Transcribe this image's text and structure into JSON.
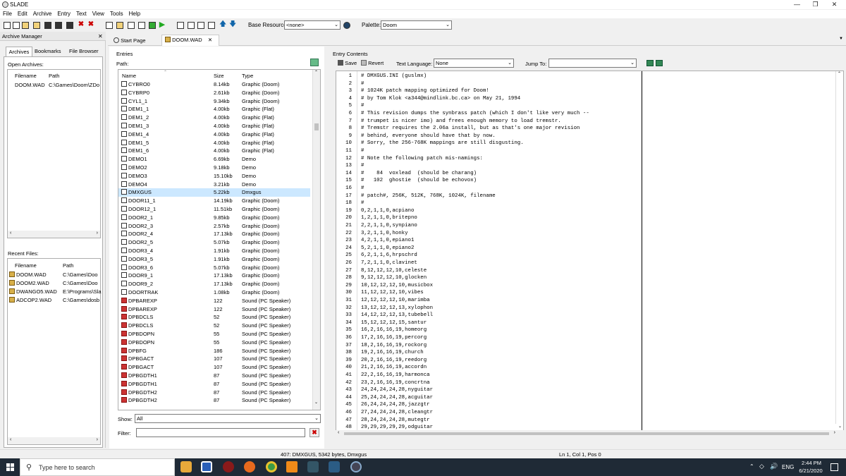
{
  "app": {
    "title": "SLADE"
  },
  "menu": [
    "File",
    "Edit",
    "Archive",
    "Entry",
    "Text",
    "View",
    "Tools",
    "Help"
  ],
  "toolbar": {
    "base_resource_label": "Base Resource:",
    "base_resource_value": "<none>",
    "palette_label": "Palette:",
    "palette_value": "Doom"
  },
  "archive_manager": {
    "title": "Archive Manager",
    "tabs": [
      "Archives",
      "Bookmarks",
      "File Browser"
    ],
    "open_archives_label": "Open Archives:",
    "columns": [
      "Filename",
      "Path"
    ],
    "open_archives": [
      {
        "filename": "DOOM.WAD",
        "path": "C:\\Games\\Doom\\ZDo"
      }
    ],
    "recent_label": "Recent Files:",
    "recent": [
      {
        "filename": "DOOM.WAD",
        "path": "C:\\Games\\Doo"
      },
      {
        "filename": "DOOM2.WAD",
        "path": "C:\\Games\\Doo"
      },
      {
        "filename": "DWANGO5.WAD",
        "path": "E:\\Programs\\Sla"
      },
      {
        "filename": "ADCOP2.WAD",
        "path": "C:\\Games\\dosb"
      }
    ]
  },
  "doc_tabs": [
    "Start Page",
    "DOOM.WAD"
  ],
  "entries": {
    "title": "Entries",
    "path_label": "Path:",
    "columns": [
      "Name",
      "Size",
      "Type"
    ],
    "rows": [
      {
        "name": "CYBRO0",
        "size": "8.14kb",
        "type": "Graphic (Doom)"
      },
      {
        "name": "CYBRP0",
        "size": "2.61kb",
        "type": "Graphic (Doom)"
      },
      {
        "name": "CYL1_1",
        "size": "9.34kb",
        "type": "Graphic (Doom)"
      },
      {
        "name": "DEM1_1",
        "size": "4.00kb",
        "type": "Graphic (Flat)"
      },
      {
        "name": "DEM1_2",
        "size": "4.00kb",
        "type": "Graphic (Flat)"
      },
      {
        "name": "DEM1_3",
        "size": "4.00kb",
        "type": "Graphic (Flat)"
      },
      {
        "name": "DEM1_4",
        "size": "4.00kb",
        "type": "Graphic (Flat)"
      },
      {
        "name": "DEM1_5",
        "size": "4.00kb",
        "type": "Graphic (Flat)"
      },
      {
        "name": "DEM1_6",
        "size": "4.00kb",
        "type": "Graphic (Flat)"
      },
      {
        "name": "DEMO1",
        "size": "6.69kb",
        "type": "Demo"
      },
      {
        "name": "DEMO2",
        "size": "9.18kb",
        "type": "Demo"
      },
      {
        "name": "DEMO3",
        "size": "15.10kb",
        "type": "Demo"
      },
      {
        "name": "DEMO4",
        "size": "3.21kb",
        "type": "Demo"
      },
      {
        "name": "DMXGUS",
        "size": "5.22kb",
        "type": "Dmxgus"
      },
      {
        "name": "DOOR11_1",
        "size": "14.19kb",
        "type": "Graphic (Doom)"
      },
      {
        "name": "DOOR12_1",
        "size": "11.51kb",
        "type": "Graphic (Doom)"
      },
      {
        "name": "DOOR2_1",
        "size": "9.85kb",
        "type": "Graphic (Doom)"
      },
      {
        "name": "DOOR2_3",
        "size": "2.57kb",
        "type": "Graphic (Doom)"
      },
      {
        "name": "DOOR2_4",
        "size": "17.13kb",
        "type": "Graphic (Doom)"
      },
      {
        "name": "DOOR2_5",
        "size": "5.07kb",
        "type": "Graphic (Doom)"
      },
      {
        "name": "DOOR3_4",
        "size": "1.91kb",
        "type": "Graphic (Doom)"
      },
      {
        "name": "DOOR3_5",
        "size": "1.91kb",
        "type": "Graphic (Doom)"
      },
      {
        "name": "DOOR3_6",
        "size": "5.07kb",
        "type": "Graphic (Doom)"
      },
      {
        "name": "DOOR9_1",
        "size": "17.13kb",
        "type": "Graphic (Doom)"
      },
      {
        "name": "DOOR9_2",
        "size": "17.13kb",
        "type": "Graphic (Doom)"
      },
      {
        "name": "DOORTRAK",
        "size": "1.08kb",
        "type": "Graphic (Doom)"
      },
      {
        "name": "DPBAREXP",
        "size": "122",
        "type": "Sound (PC Speaker)"
      },
      {
        "name": "DPBAREXP",
        "size": "122",
        "type": "Sound (PC Speaker)"
      },
      {
        "name": "DPBDCLS",
        "size": "52",
        "type": "Sound (PC Speaker)"
      },
      {
        "name": "DPBDCLS",
        "size": "52",
        "type": "Sound (PC Speaker)"
      },
      {
        "name": "DPBDOPN",
        "size": "55",
        "type": "Sound (PC Speaker)"
      },
      {
        "name": "DPBDOPN",
        "size": "55",
        "type": "Sound (PC Speaker)"
      },
      {
        "name": "DPBFG",
        "size": "186",
        "type": "Sound (PC Speaker)"
      },
      {
        "name": "DPBGACT",
        "size": "107",
        "type": "Sound (PC Speaker)"
      },
      {
        "name": "DPBGACT",
        "size": "107",
        "type": "Sound (PC Speaker)"
      },
      {
        "name": "DPBGDTH1",
        "size": "87",
        "type": "Sound (PC Speaker)"
      },
      {
        "name": "DPBGDTH1",
        "size": "87",
        "type": "Sound (PC Speaker)"
      },
      {
        "name": "DPBGDTH2",
        "size": "87",
        "type": "Sound (PC Speaker)"
      },
      {
        "name": "DPBGDTH2",
        "size": "87",
        "type": "Sound (PC Speaker)"
      }
    ],
    "show_label": "Show:",
    "show_value": "All",
    "filter_label": "Filter:"
  },
  "entry_contents": {
    "title": "Entry Contents",
    "save": "Save",
    "revert": "Revert",
    "text_language_label": "Text Language:",
    "text_language_value": "None",
    "jump_to_label": "Jump To:",
    "lines": [
      "# DMXGUS.INI (guslmx)",
      "#",
      "# 1024K patch mapping optimized for Doom!",
      "# by Tom Klok <a344@mindlink.bc.ca> on May 21, 1994",
      "#",
      "# This revision dumps the synbrass patch (which I don't like very much --",
      "# trumpet is nicer imo) and frees enough memory to load tremstr.",
      "# Tremstr requires the 2.06a install, but as that's one major revision",
      "# behind, everyone should have that by now.",
      "# Sorry, the 256-768K mappings are still disgusting.",
      "#",
      "# Note the following patch mis-namings:",
      "#",
      "#    84  voxlead  (should be charang)",
      "#   102  ghostie  (should be echovox)",
      "#",
      "# patch#, 256K, 512K, 768K, 1024K, filename",
      "#",
      "0,2,1,1,0,acpiano",
      "1,2,1,1,0,britepno",
      "2,2,1,1,0,synpiano",
      "3,2,1,1,0,honky",
      "4,2,1,1,0,epiano1",
      "5,2,1,1,0,epiano2",
      "6,2,1,1,6,hrpschrd",
      "7,2,1,1,0,clavinet",
      "8,12,12,12,10,celeste",
      "9,12,12,12,10,glocken",
      "10,12,12,12,10,musicbox",
      "11,12,12,12,10,vibes",
      "12,12,12,12,10,marimba",
      "13,12,12,12,13,xylophon",
      "14,12,12,12,13,tubebell",
      "15,12,12,12,15,santur",
      "16,2,16,16,19,homeorg",
      "17,2,16,16,19,percorg",
      "18,2,16,16,19,rockorg",
      "19,2,16,16,19,church",
      "20,2,16,16,19,reedorg",
      "21,2,16,16,19,accordn",
      "22,2,16,16,19,harmonca",
      "23,2,16,16,19,concrtna",
      "24,24,24,24,28,nyguitar",
      "25,24,24,24,28,acguitar",
      "26,24,24,24,28,jazzgtr",
      "27,24,24,24,28,cleangtr",
      "28,24,24,24,28,mutegtr",
      "29,29,29,29,29,odguitar"
    ]
  },
  "status": {
    "entry_info": "407: DMXGUS, 5342 bytes, Dmxgus",
    "cursor": "Ln 1, Col 1, Pos 0"
  },
  "taskbar": {
    "search_placeholder": "Type here to search",
    "lang": "ENG",
    "time": "2:44 PM",
    "date": "6/21/2020"
  }
}
